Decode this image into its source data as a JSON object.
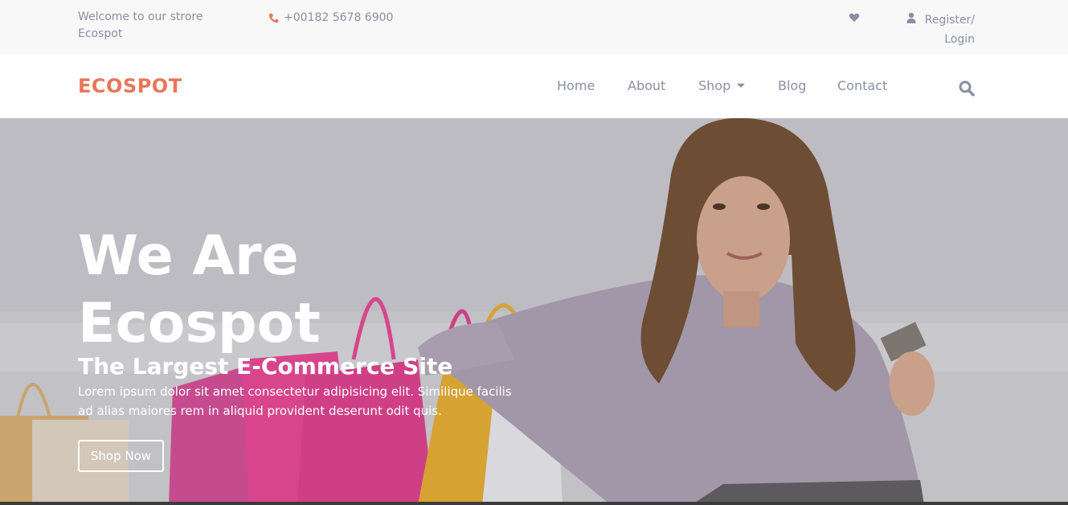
{
  "topbar": {
    "welcome": "Welcome to our strore Ecospot",
    "phone": "+00182 5678 6900",
    "register": "Register/",
    "login": "Login"
  },
  "navbar": {
    "logo": "ECOSPOT",
    "items": [
      {
        "label": "Home"
      },
      {
        "label": "About"
      },
      {
        "label": "Shop"
      },
      {
        "label": "Blog"
      },
      {
        "label": "Contact"
      }
    ]
  },
  "hero": {
    "title_line1": "We Are",
    "title_line2": "Ecospot",
    "subtitle": "The Largest E-Commerce Site",
    "text": "Lorem ipsum dolor sit amet consectetur adipisicing elit. Similique facilis ad alias maiores rem in aliquid provident deserunt odit quis.",
    "button": "Shop Now"
  },
  "colors": {
    "brand": "#e8765b",
    "nav_text": "#8a8fa3",
    "topbar_bg": "#f8f8f8",
    "hero_text": "#ffffff"
  },
  "icons": [
    "phone-icon",
    "heart-icon",
    "user-icon",
    "search-icon"
  ]
}
